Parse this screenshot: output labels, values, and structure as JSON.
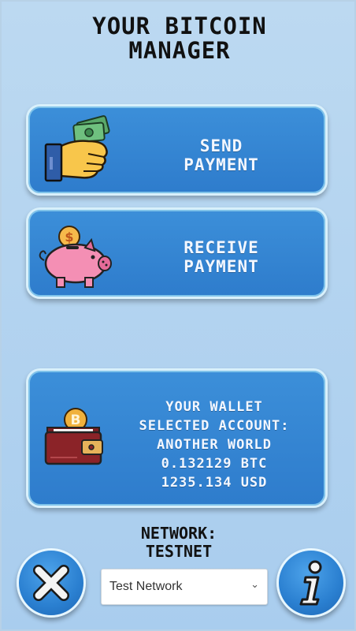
{
  "header": {
    "title_line1": "YOUR BITCOIN",
    "title_line2": "MANAGER"
  },
  "send_button": {
    "line1": "SEND",
    "line2": "PAYMENT",
    "icon": "hand-cash-icon"
  },
  "receive_button": {
    "line1": "RECEIVE",
    "line2": "PAYMENT",
    "icon": "piggy-bank-icon"
  },
  "wallet": {
    "line1": "YOUR WALLET",
    "line2": "SELECTED ACCOUNT:",
    "account": "ANOTHER WORLD",
    "btc_balance": "0.132129 BTC",
    "usd_balance": "1235.134 USD",
    "icon": "bitcoin-wallet-icon"
  },
  "network": {
    "label_line1": "NETWORK:",
    "label_line2": "TESTNET"
  },
  "network_select": {
    "value": "Test Network"
  },
  "footer": {
    "close_icon": "close-icon",
    "info_icon": "info-icon"
  },
  "colors": {
    "background": "#bcd9f1",
    "button": "#2e7ccc",
    "button_border": "#d8f0fb"
  }
}
